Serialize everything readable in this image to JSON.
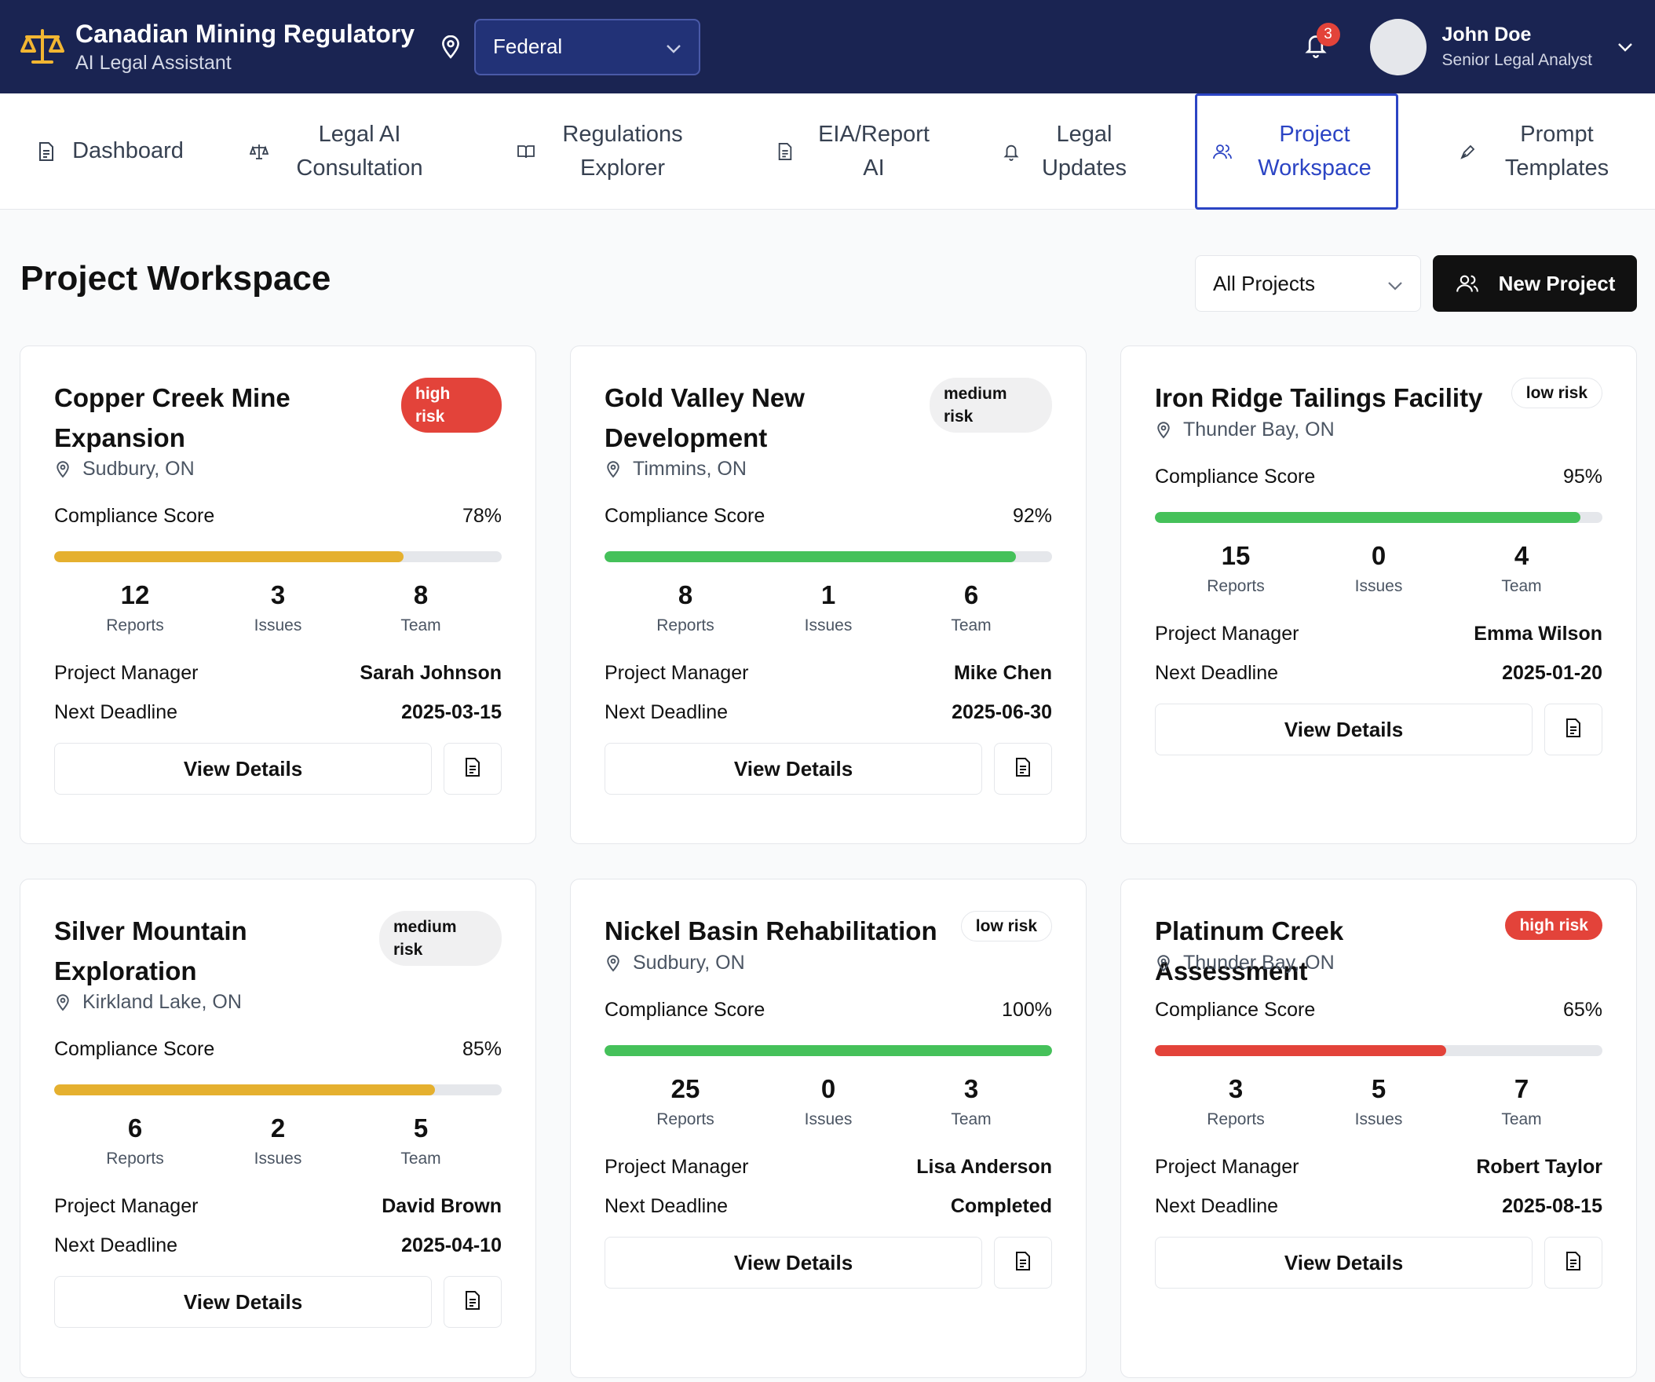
{
  "header": {
    "title": "Canadian Mining Regulatory",
    "subtitle": "AI Legal Assistant",
    "jurisdiction": "Federal",
    "notifications": "3",
    "user_name": "John Doe",
    "user_role": "Senior Legal Analyst"
  },
  "nav": {
    "tabs": [
      {
        "label": "Dashboard",
        "icon": "document-icon"
      },
      {
        "label": "Legal AI Consultation",
        "icon": "scale-icon"
      },
      {
        "label": "Regulations Explorer",
        "icon": "book-icon"
      },
      {
        "label": "EIA/Report AI",
        "icon": "document-icon"
      },
      {
        "label": "Legal Updates",
        "icon": "bell-icon"
      },
      {
        "label": "Project Workspace",
        "icon": "users-icon",
        "active": true
      },
      {
        "label": "Prompt Templates",
        "icon": "pen-icon"
      }
    ]
  },
  "page": {
    "title": "Project Workspace",
    "filter": "All Projects",
    "new_project": "New Project"
  },
  "labels": {
    "compliance": "Compliance Score",
    "reports": "Reports",
    "issues": "Issues",
    "team": "Team",
    "pm": "Project Manager",
    "deadline": "Next Deadline",
    "view": "View Details"
  },
  "colors": {
    "header_bg": "#1a2452",
    "accent": "#2b44c4",
    "high": "#e3433a",
    "medium_bar": "#e5b02f",
    "good_bar": "#45c15a"
  },
  "projects": [
    {
      "title": "Copper Creek Mine Expansion",
      "title_lines": [
        "Copper Creek Mine",
        "Expansion"
      ],
      "risk": "high risk",
      "risk_lines": [
        "high",
        "risk"
      ],
      "risk_level": "high",
      "location": "Sudbury, ON",
      "score": "78%",
      "score_value": 78,
      "bar_color": "#e5b02f",
      "reports": "12",
      "issues": "3",
      "team": "8",
      "manager": "Sarah Johnson",
      "deadline": "2025-03-15"
    },
    {
      "title": "Gold Valley New Development",
      "title_lines": [
        "Gold Valley New",
        "Development"
      ],
      "risk": "medium risk",
      "risk_lines": [
        "medium",
        "risk"
      ],
      "risk_level": "medium",
      "location": "Timmins, ON",
      "score": "92%",
      "score_value": 92,
      "bar_color": "#45c15a",
      "reports": "8",
      "issues": "1",
      "team": "6",
      "manager": "Mike Chen",
      "deadline": "2025-06-30"
    },
    {
      "title": "Iron Ridge Tailings Facility",
      "title_lines": [
        "Iron Ridge Tailings Facility"
      ],
      "risk": "low risk",
      "risk_lines": [
        "low risk"
      ],
      "risk_level": "low",
      "location": "Thunder Bay, ON",
      "score": "95%",
      "score_value": 95,
      "bar_color": "#45c15a",
      "reports": "15",
      "issues": "0",
      "team": "4",
      "manager": "Emma Wilson",
      "deadline": "2025-01-20"
    },
    {
      "title": "Silver Mountain Exploration",
      "title_lines": [
        "Silver Mountain",
        "Exploration"
      ],
      "risk": "medium risk",
      "risk_lines": [
        "medium",
        "risk"
      ],
      "risk_level": "medium",
      "location": "Kirkland Lake, ON",
      "score": "85%",
      "score_value": 85,
      "bar_color": "#e5b02f",
      "reports": "6",
      "issues": "2",
      "team": "5",
      "manager": "David Brown",
      "deadline": "2025-04-10"
    },
    {
      "title": "Nickel Basin Rehabilitation",
      "title_lines": [
        "Nickel Basin Rehabilitation"
      ],
      "risk": "low risk",
      "risk_lines": [
        "low risk"
      ],
      "risk_level": "low",
      "location": "Sudbury, ON",
      "score": "100%",
      "score_value": 100,
      "bar_color": "#45c15a",
      "reports": "25",
      "issues": "0",
      "team": "3",
      "manager": "Lisa Anderson",
      "deadline": "Completed"
    },
    {
      "title": "Platinum Creek Assessment",
      "title_lines": [
        "Platinum Creek Assessment"
      ],
      "risk": "high risk",
      "risk_lines": [
        "high risk"
      ],
      "risk_level": "high",
      "location": "Thunder Bay, ON",
      "score": "65%",
      "score_value": 65,
      "bar_color": "#e3433a",
      "reports": "3",
      "issues": "5",
      "team": "7",
      "manager": "Robert Taylor",
      "deadline": "2025-08-15"
    }
  ]
}
